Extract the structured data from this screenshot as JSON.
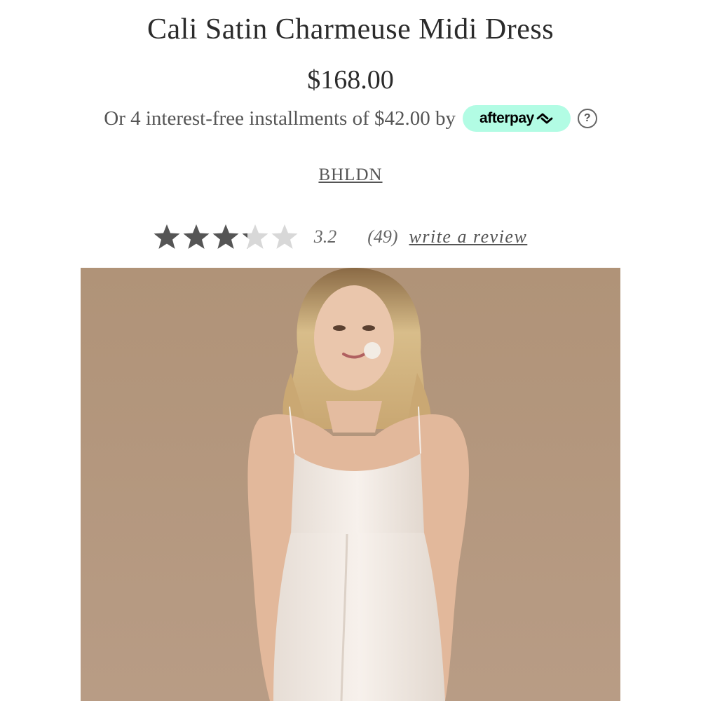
{
  "product": {
    "title": "Cali Satin Charmeuse Midi Dress",
    "price": "$168.00",
    "installments_text": "Or 4 interest-free installments of $42.00 by",
    "afterpay_label": "afterpay",
    "help_symbol": "?",
    "brand": "BHLDN"
  },
  "rating": {
    "value": 3.2,
    "max": 5,
    "value_text": "3.2",
    "count_text": "(49)",
    "write_review_label": "write a review"
  },
  "colors": {
    "afterpay_mint": "#b2fce4",
    "star_filled": "#555555",
    "star_empty": "#d8d8d8",
    "image_background": "#b3967f"
  },
  "icons": {
    "help": "question-circle-icon",
    "afterpay": "afterpay-arrows-icon",
    "star": "star-icon"
  }
}
